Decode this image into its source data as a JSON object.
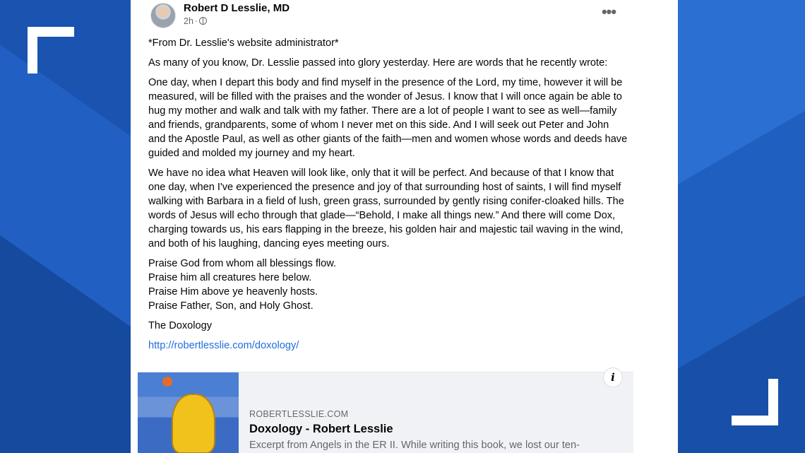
{
  "post": {
    "author": "Robert D Lesslie, MD",
    "time": "2h",
    "dot": "·",
    "more_label": "•••",
    "paragraphs": [
      "*From Dr. Lesslie's website administrator*",
      "As many of you know, Dr. Lesslie passed into glory yesterday. Here are words that he recently wrote:",
      "One day, when I depart this body and find myself in the presence of the Lord, my time, however it will be measured, will be filled with the praises and the wonder of Jesus. I know that I will once again be able to hug my mother and walk and talk with my father. There are a lot of people I want to see as well—family and friends, grandparents, some of whom I never met on this side. And I will seek out Peter and John and the Apostle Paul, as well as other giants of the faith—men and women whose words and deeds have guided and molded my journey and my heart.",
      "We have no idea what Heaven will look like, only that it will be perfect. And because of that I know that one day, when I've experienced the presence and joy of that surrounding host of saints, I will find myself walking with Barbara in a field of lush, green grass, surrounded by gently rising conifer-cloaked hills. The words of Jesus will echo through that glade—“Behold, I make all things new.” And there will come Dox, charging towards us, his ears flapping in the breeze, his golden hair and majestic tail waving in the wind, and both of his laughing, dancing eyes meeting ours."
    ],
    "praise_lines": [
      "Praise God from whom all blessings flow.",
      "Praise him all creatures here below.",
      "Praise Him above ye heavenly hosts.",
      "Praise Father, Son, and Holy Ghost."
    ],
    "closing": "The Doxology",
    "link": "http://robertlesslie.com/doxology/"
  },
  "preview": {
    "site": "ROBERTLESSLIE.COM",
    "title": "Doxology - Robert Lesslie",
    "description": "Excerpt from Angels in the ER II. While writing this book, we lost our ten-",
    "info_icon": "i"
  },
  "colors": {
    "background": "#1f5ab8",
    "link": "#216fdb",
    "bracket": "#ffffff"
  }
}
